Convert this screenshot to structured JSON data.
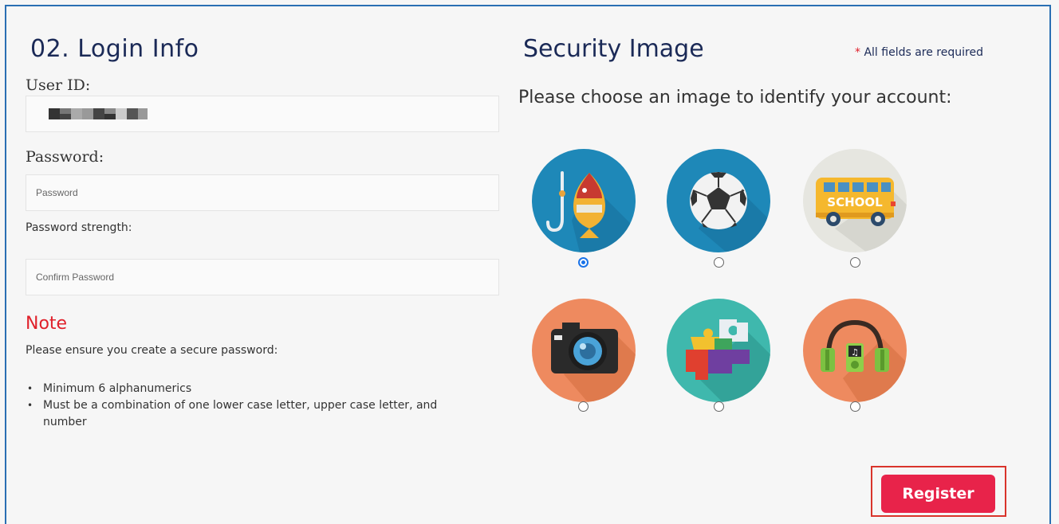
{
  "login": {
    "heading": "02. Login Info",
    "user_id_label": "User ID:",
    "password_label": "Password:",
    "password_placeholder": "Password",
    "strength_label": "Password strength:",
    "confirm_placeholder": "Confirm Password"
  },
  "note": {
    "title": "Note",
    "intro": "Please ensure you create a secure password:",
    "rules": [
      "Minimum 6 alphanumerics",
      "Must be a combination of one lower case letter, upper case letter, and number"
    ]
  },
  "security": {
    "heading": "Security Image",
    "required_star": "*",
    "required_text": " All fields are required",
    "prompt": "Please choose an image to identify your account:",
    "images": [
      {
        "icon": "fish-hook-icon",
        "selected": true
      },
      {
        "icon": "soccer-ball-icon",
        "selected": false
      },
      {
        "icon": "school-bus-icon",
        "selected": false,
        "text": "SCHOOL"
      },
      {
        "icon": "camera-icon",
        "selected": false
      },
      {
        "icon": "puzzle-icon",
        "selected": false
      },
      {
        "icon": "headphones-music-icon",
        "selected": false
      }
    ]
  },
  "actions": {
    "register_label": "Register"
  },
  "colors": {
    "frame": "#2a6fb3",
    "heading": "#1b2a57",
    "note": "#e0212b",
    "register": "#e8234a",
    "tile_blue": "#1e88b8",
    "tile_grey": "#e6e6e0",
    "tile_orange": "#ee8a5f"
  }
}
